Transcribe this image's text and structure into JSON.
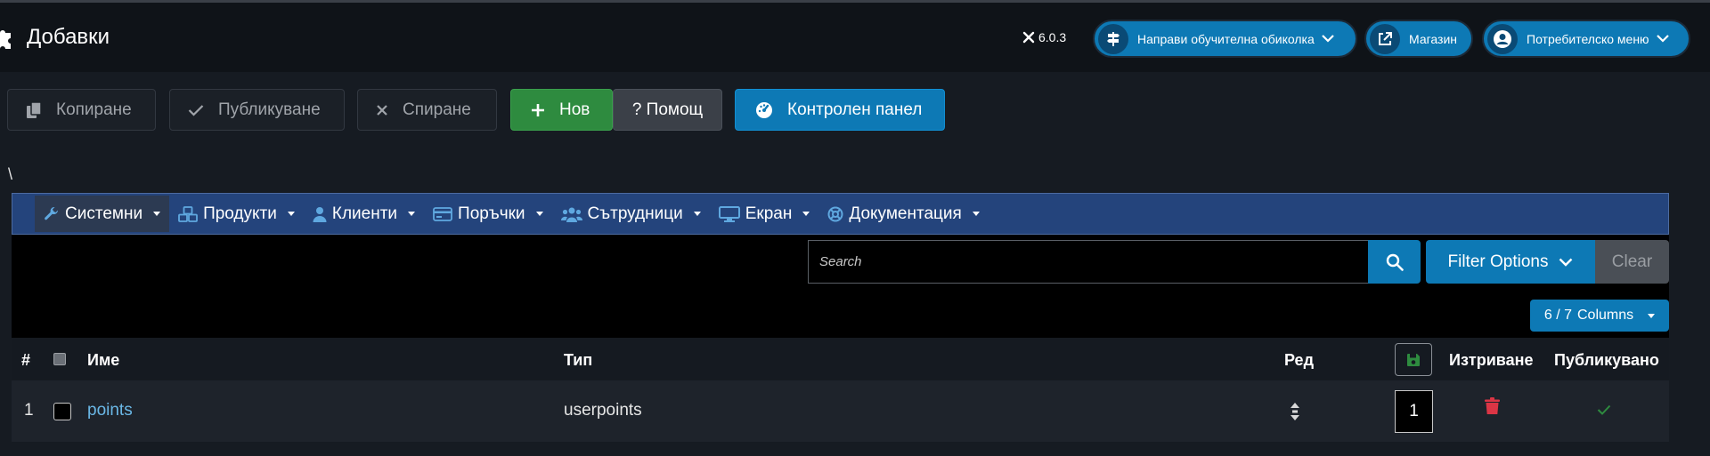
{
  "header": {
    "title": "Добавки",
    "version": "6.0.3",
    "buttons": [
      {
        "label": "Направи обучителна обиколка",
        "icon": "signpost-icon"
      },
      {
        "label": "Магазин",
        "icon": "external-link-icon"
      },
      {
        "label": "Потребителско меню",
        "icon": "user-icon"
      }
    ]
  },
  "toolbar": {
    "copy": "Копиране",
    "publish": "Публикуване",
    "unpublish": "Спиране",
    "new": "Нов",
    "help": "? Помощ",
    "dashboard": "Контролен панел"
  },
  "misc": {
    "backslash": "\\"
  },
  "menu": [
    {
      "label": "Системни",
      "icon": "wrench-icon"
    },
    {
      "label": "Продукти",
      "icon": "cubes-icon"
    },
    {
      "label": "Клиенти",
      "icon": "user-icon"
    },
    {
      "label": "Поръчки",
      "icon": "credit-card-icon"
    },
    {
      "label": "Сътрудници",
      "icon": "users-icon"
    },
    {
      "label": "Екран",
      "icon": "desktop-icon"
    },
    {
      "label": "Документация",
      "icon": "life-ring-icon"
    }
  ],
  "filters": {
    "search_placeholder": "Search",
    "filter_options": "Filter Options",
    "clear": "Clear",
    "columns_count": "6 / 7",
    "columns_label": "Columns"
  },
  "table": {
    "headers": {
      "num": "#",
      "name": "Име",
      "type": "Тип",
      "order": "Ред",
      "delete": "Изтриване",
      "published": "Публикувано"
    },
    "rows": [
      {
        "num": "1",
        "name": "points",
        "type": "userpoints",
        "order": "1"
      }
    ]
  },
  "colors": {
    "accent": "#0d79b5",
    "success": "#2e8b3f",
    "menubar": "#24447c",
    "danger": "#dc3545"
  }
}
